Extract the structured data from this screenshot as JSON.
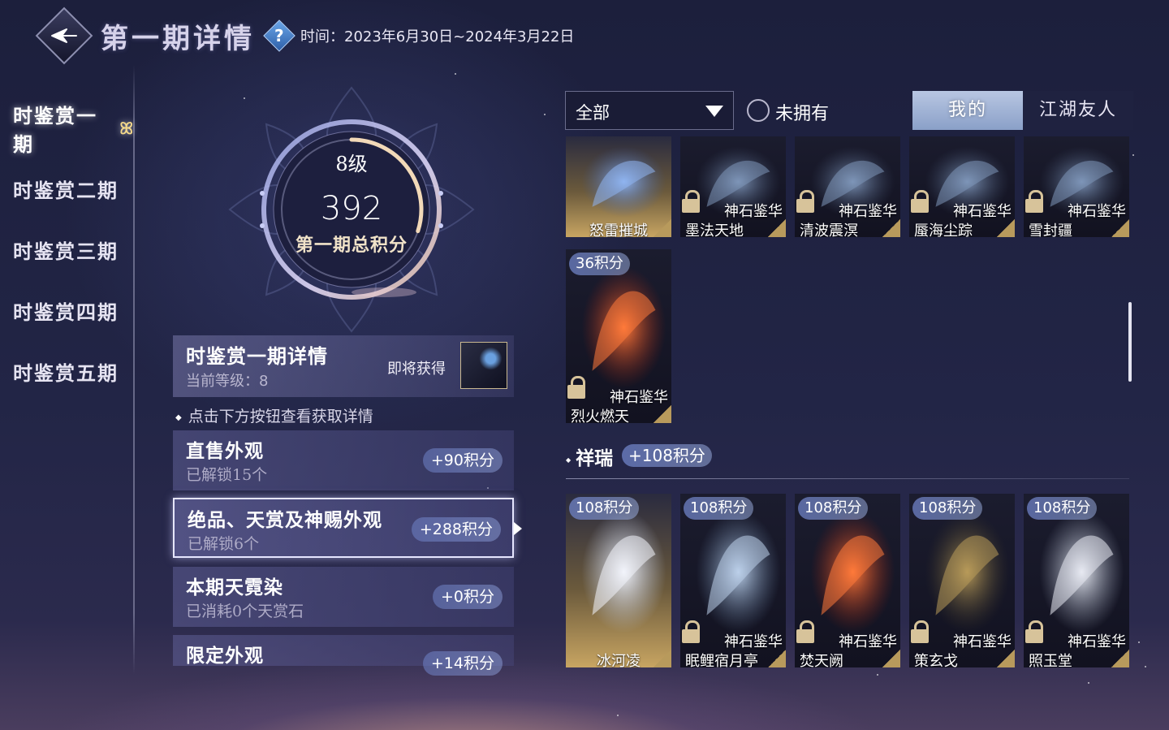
{
  "header": {
    "title": "第一期详情",
    "help_icon": "question-icon",
    "time_label": "时间：2023年6月30日~2024年3月22日"
  },
  "sidebar": {
    "items": [
      {
        "label": "时鉴赏一期",
        "active": true
      },
      {
        "label": "时鉴赏二期",
        "active": false
      },
      {
        "label": "时鉴赏三期",
        "active": false
      },
      {
        "label": "时鉴赏四期",
        "active": false
      },
      {
        "label": "时鉴赏五期",
        "active": false
      }
    ],
    "active_marker": "ꕤ"
  },
  "ring": {
    "level": "8级",
    "score": "392",
    "score_label": "第一期总积分",
    "progress": 0.3
  },
  "detail": {
    "title": "时鉴赏一期详情",
    "sub": "当前等级：8",
    "soon": "即将获得"
  },
  "tip": "点击下方按钮查看获取详情",
  "categories": [
    {
      "title": "直售外观",
      "sub": "已解锁15个",
      "points": "+90积分",
      "active": false
    },
    {
      "title": "绝品、天赏及神赐外观",
      "sub": "已解锁6个",
      "points": "+288积分",
      "active": true
    },
    {
      "title": "本期天霓染",
      "sub": "已消耗0个天赏石",
      "points": "+0积分",
      "active": false
    },
    {
      "title": "限定外观",
      "sub": "",
      "points": "+14积分",
      "active": false
    }
  ],
  "filter": {
    "value": "全部",
    "unowned_label": "未拥有",
    "unowned_checked": false
  },
  "tabs": [
    {
      "label": "我的",
      "active": true
    },
    {
      "label": "江湖友人",
      "active": false
    }
  ],
  "top_row": [
    {
      "badge": "",
      "name": "怒雷摧城",
      "locked": false,
      "style": "gold"
    },
    {
      "badge": "神石鉴华",
      "name": "墨法天地",
      "locked": true,
      "style": "dark"
    },
    {
      "badge": "神石鉴华",
      "name": "清波震溟",
      "locked": true,
      "style": "dark"
    },
    {
      "badge": "神石鉴华",
      "name": "蜃海尘踪",
      "locked": true,
      "style": "dark"
    },
    {
      "badge": "神石鉴华",
      "name": "雪封疆",
      "locked": true,
      "style": "dark"
    }
  ],
  "mid_card": {
    "points": "36积分",
    "badge": "神石鉴华",
    "name": "烈火燃天",
    "locked": true
  },
  "section": {
    "title": "祥瑞",
    "points": "+108积分"
  },
  "bottom_row": [
    {
      "points": "108积分",
      "badge": "",
      "name": "冰河凌",
      "locked": false,
      "style": "gold",
      "art": "fox"
    },
    {
      "points": "108积分",
      "badge": "神石鉴华",
      "name": "眠鲤宿月亭",
      "locked": true,
      "style": "dark",
      "art": "ice"
    },
    {
      "points": "108积分",
      "badge": "神石鉴华",
      "name": "焚天阙",
      "locked": true,
      "style": "dark",
      "art": "fire"
    },
    {
      "points": "108积分",
      "badge": "神石鉴华",
      "name": "策玄戈",
      "locked": true,
      "style": "dark",
      "art": "gold-dragon"
    },
    {
      "points": "108积分",
      "badge": "神石鉴华",
      "name": "照玉堂",
      "locked": true,
      "style": "dark",
      "art": "white-dragon"
    }
  ],
  "colors": {
    "background": "#222546",
    "accent_gold": "#d7c39a",
    "points_pill": "#7e92d0",
    "tab_active": "#a4b4d6"
  }
}
